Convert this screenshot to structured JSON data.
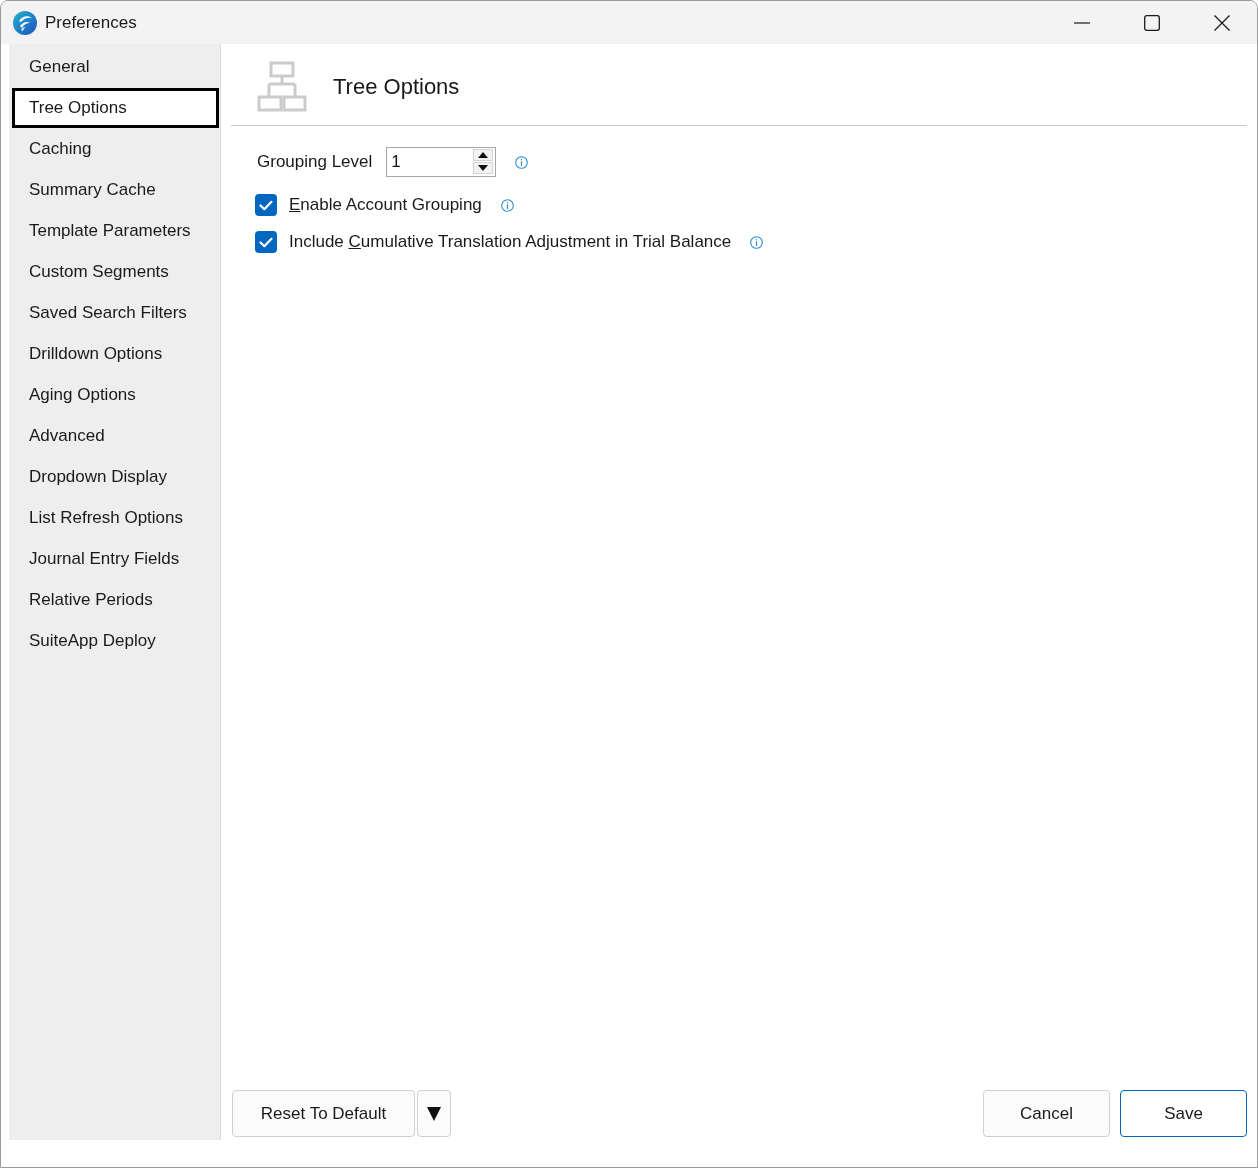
{
  "window": {
    "title": "Preferences"
  },
  "sidebar": {
    "items": [
      {
        "label": "General",
        "selected": false
      },
      {
        "label": "Tree Options",
        "selected": true
      },
      {
        "label": "Caching",
        "selected": false
      },
      {
        "label": "Summary Cache",
        "selected": false
      },
      {
        "label": "Template Parameters",
        "selected": false
      },
      {
        "label": "Custom Segments",
        "selected": false
      },
      {
        "label": "Saved Search Filters",
        "selected": false
      },
      {
        "label": "Drilldown Options",
        "selected": false
      },
      {
        "label": "Aging Options",
        "selected": false
      },
      {
        "label": "Advanced",
        "selected": false
      },
      {
        "label": "Dropdown Display",
        "selected": false
      },
      {
        "label": "List Refresh Options",
        "selected": false
      },
      {
        "label": "Journal Entry Fields",
        "selected": false
      },
      {
        "label": "Relative Periods",
        "selected": false
      },
      {
        "label": "SuiteApp Deploy",
        "selected": false
      }
    ]
  },
  "section": {
    "title": "Tree Options"
  },
  "settings": [
    {
      "kind": "spinner",
      "label": "Grouping Level",
      "value": "1"
    },
    {
      "kind": "checkbox",
      "checked": true,
      "access_key": "E",
      "label_after": "nable Account Grouping"
    },
    {
      "kind": "checkbox",
      "checked": true,
      "label_before": "Include ",
      "access_key": "C",
      "label_after": "umulative Translation Adjustment in Trial Balance"
    }
  ],
  "footer": {
    "reset_button": "Reset To Default",
    "buttons": [
      {
        "label": "Cancel",
        "default": false
      },
      {
        "label": "Save",
        "default": true
      }
    ]
  }
}
